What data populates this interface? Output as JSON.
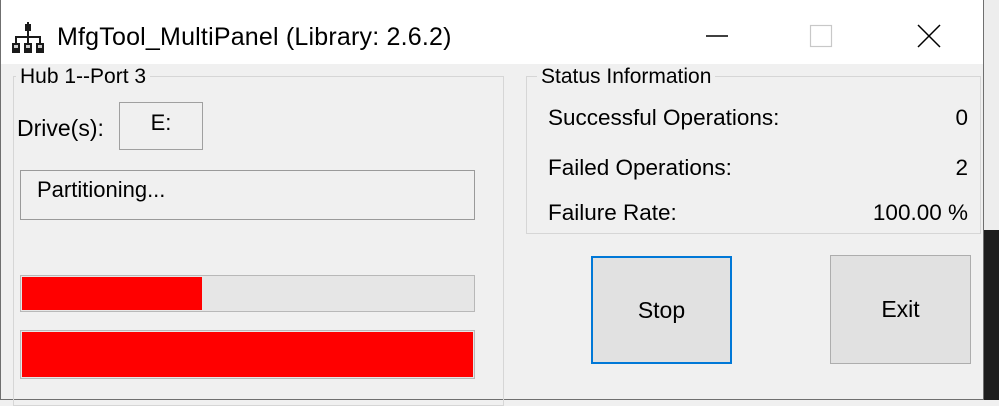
{
  "window": {
    "title": "MfgTool_MultiPanel (Library: 2.6.2)",
    "icon": "network-hub-icon",
    "controls": [
      "minimize-icon",
      "maximize-icon",
      "close-icon"
    ]
  },
  "hub_panel": {
    "label": "Hub 1--Port 3",
    "drive_label": "Drive(s):",
    "drive_value": "E:",
    "status_text": "Partitioning...",
    "progress_primary": 0.4,
    "progress_secondary": 1.0,
    "progress_color": "#ff0000"
  },
  "status_panel": {
    "label": "Status Information",
    "rows": [
      {
        "label": "Successful Operations:",
        "value": "0"
      },
      {
        "label": "Failed Operations:",
        "value": "2"
      },
      {
        "label": "Failure Rate:",
        "value": "100.00 %"
      }
    ]
  },
  "buttons": {
    "stop_label": "Stop",
    "exit_label": "Exit"
  },
  "colors": {
    "focus_border": "#0078d7",
    "progress_fill": "#ff0000"
  }
}
